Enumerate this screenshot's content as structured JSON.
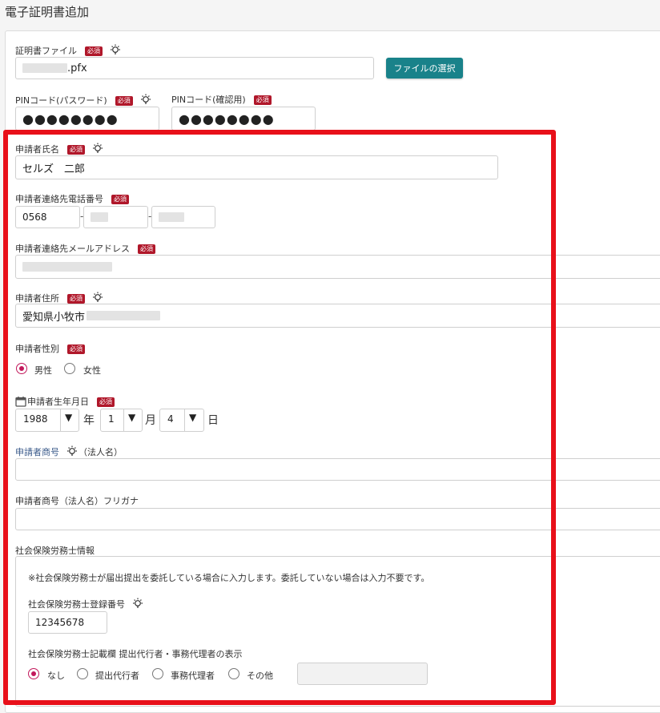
{
  "page": {
    "title": "電子証明書追加"
  },
  "cert_file": {
    "label": "証明書ファイル",
    "required": "必須",
    "value_suffix": ".pfx",
    "select_button": "ファイルの選択"
  },
  "pin": {
    "label": "PINコード(パスワード)",
    "required": "必須",
    "value": "●●●●●●●●"
  },
  "pin_confirm": {
    "label": "PINコード(確認用)",
    "required": "必須",
    "value": "●●●●●●●●"
  },
  "applicant_name": {
    "label": "申請者氏名",
    "required": "必須",
    "value": "セルズ　二郎"
  },
  "applicant_phone": {
    "label": "申請者連絡先電話番号",
    "required": "必須",
    "part1": "0568",
    "separator": "-"
  },
  "applicant_email": {
    "label": "申請者連絡先メールアドレス",
    "required": "必須"
  },
  "applicant_address": {
    "label": "申請者住所",
    "required": "必須",
    "value": "愛知県小牧市"
  },
  "applicant_gender": {
    "label": "申請者性別",
    "required": "必須",
    "options": [
      "男性",
      "女性"
    ],
    "selected": "男性"
  },
  "applicant_birthdate": {
    "label": "申請者生年月日",
    "required": "必須",
    "year": "1988",
    "year_unit": "年",
    "month": "1",
    "month_unit": "月",
    "day": "4",
    "day_unit": "日",
    "arrow": "▼"
  },
  "applicant_company": {
    "label": "申請者商号",
    "label_suffix": "（法人名）"
  },
  "applicant_company_kana": {
    "label": "申請者商号（法人名）フリガナ"
  },
  "sharoushi": {
    "section_label": "社会保険労務士情報",
    "note": "※社会保険労務士が届出提出を委託している場合に入力します。委託していない場合は入力不要です。",
    "reg_number_label": "社会保険労務士登録番号",
    "reg_number_value": "12345678",
    "display_label": "社会保険労務士記載欄 提出代行者・事務代理者の表示",
    "options": [
      "なし",
      "提出代行者",
      "事務代理者",
      "その他"
    ],
    "selected": "なし"
  },
  "colors": {
    "required_badge": "#b0172a",
    "button": "#19828a",
    "radio_accent": "#c2185b",
    "highlight": "#e8101a"
  }
}
